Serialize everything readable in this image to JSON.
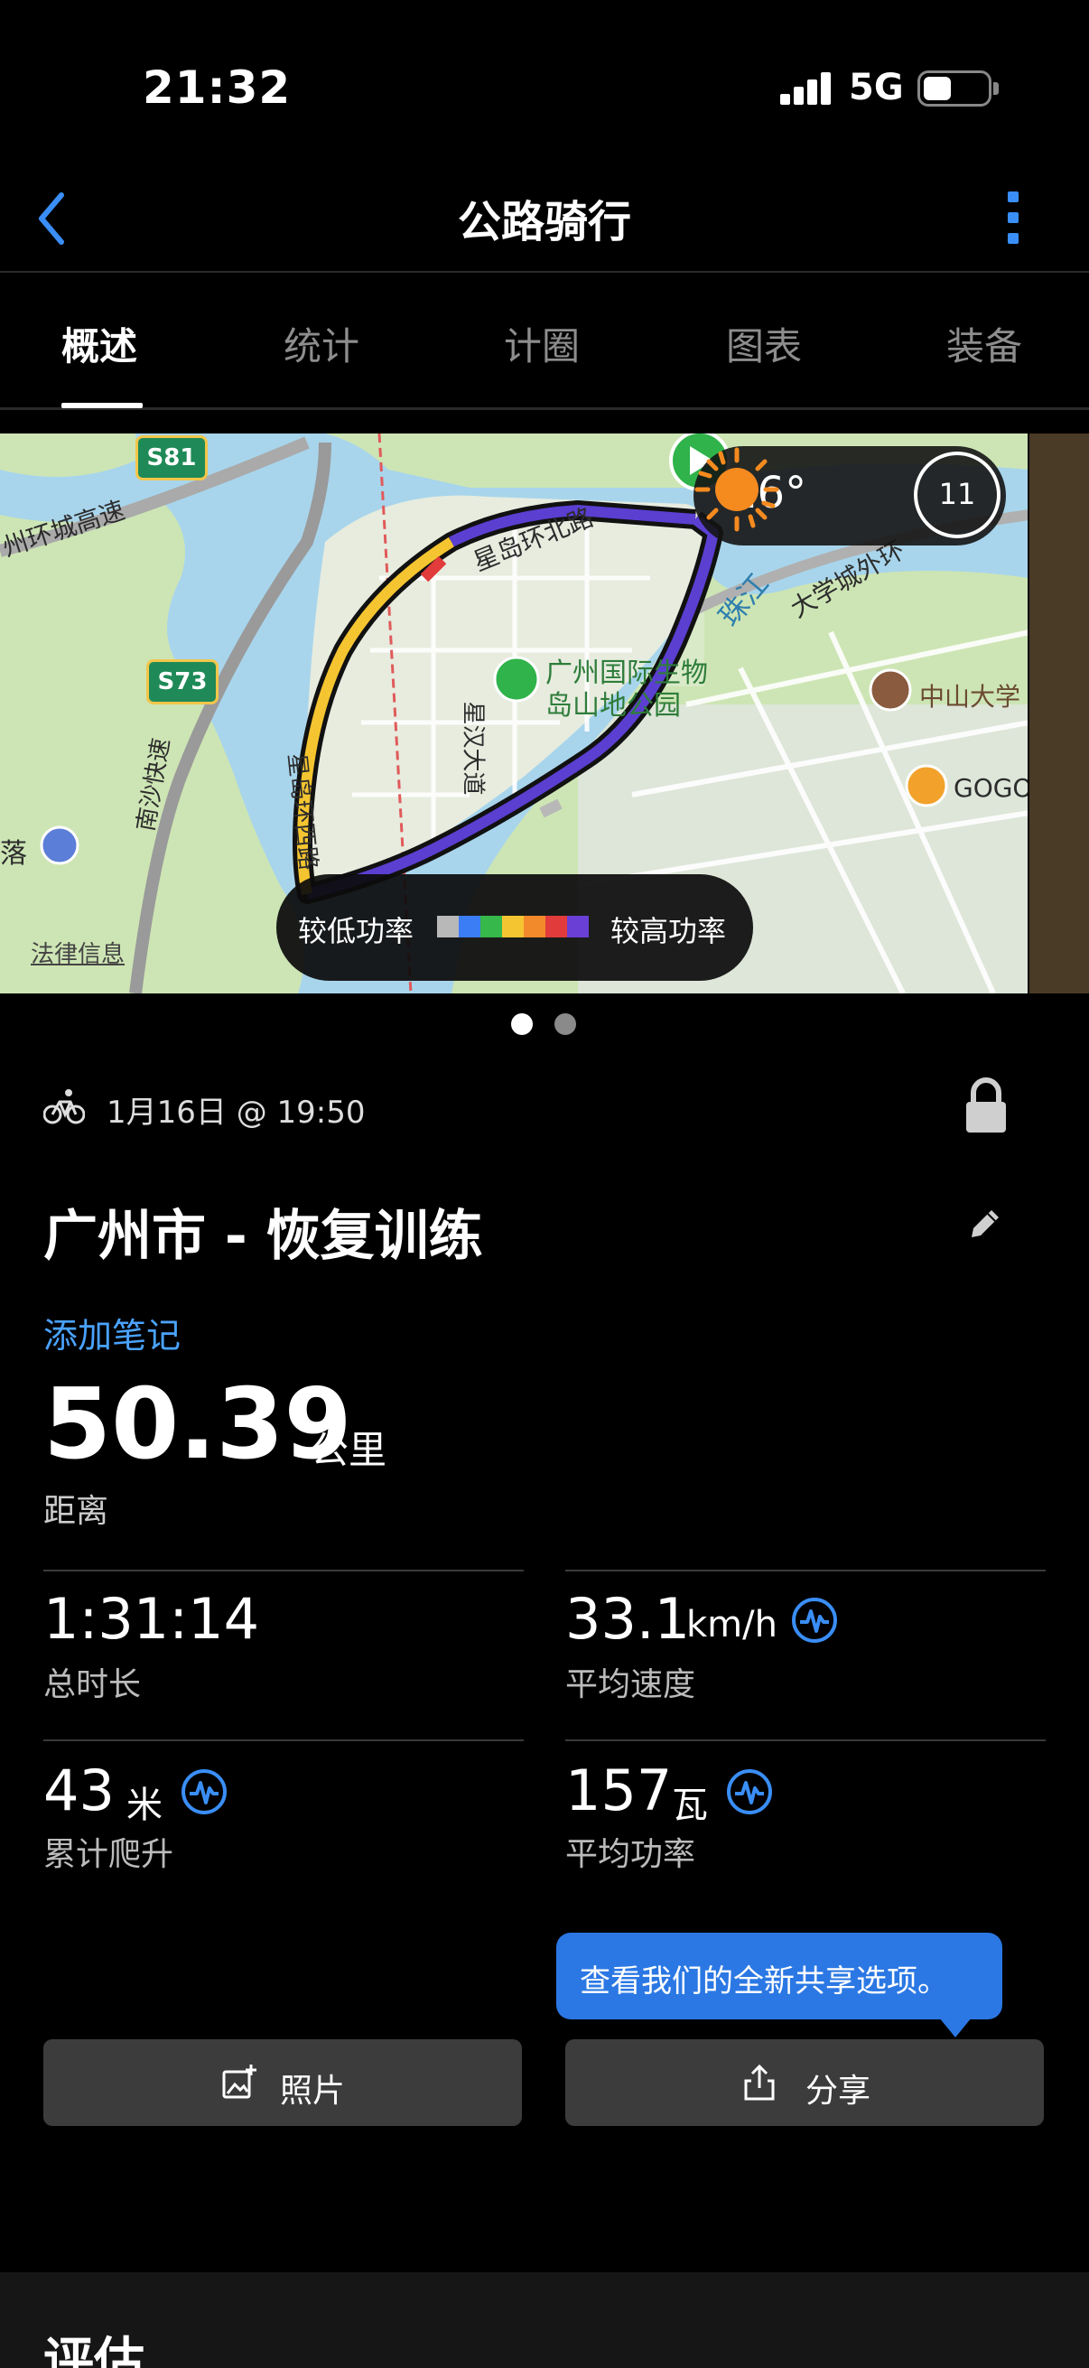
{
  "status_bar": {
    "time": "21:32",
    "network": "5G"
  },
  "nav": {
    "title": "公路骑行"
  },
  "tabs": [
    {
      "label": "概述",
      "active": true
    },
    {
      "label": "统计",
      "active": false
    },
    {
      "label": "计圈",
      "active": false
    },
    {
      "label": "图表",
      "active": false
    },
    {
      "label": "装备",
      "active": false
    }
  ],
  "map": {
    "labels": {
      "ring_expressway": "州环城高速",
      "road_north": "星岛环北路",
      "river": "珠江",
      "park": "广州国际生物",
      "park2": "岛山地公园",
      "univ_road": "大学城外环",
      "sysu": "中山大学",
      "gogo": "GOGO",
      "avenue": "星汉大道",
      "road_west": "星岛环西路",
      "south_road": "南沙快速",
      "left_place": "落",
      "legal": "法律信息",
      "s81": "S81",
      "s73": "S73"
    },
    "weather": {
      "temperature": "16°",
      "wind": "11",
      "icon": "sun-icon"
    },
    "legend": {
      "low": "较低功率",
      "high": "较高功率",
      "colors": [
        "#b8b8b8",
        "#3b7df5",
        "#36b84a",
        "#f5c531",
        "#f28a2b",
        "#e23b3b",
        "#6a3fd6"
      ]
    },
    "route_color": "#5b3fd1",
    "page_count": 2,
    "page_active": 0
  },
  "activity": {
    "date": "1月16日 @ 19:50",
    "title": "广州市 - 恢复训练",
    "add_note": "添加笔记",
    "distance": {
      "value": "50.39",
      "unit": "公里",
      "label": "距离"
    },
    "stats": [
      {
        "value": "1:31:14",
        "unit": "",
        "label": "总时长"
      },
      {
        "value": "33.1",
        "unit": "km/h",
        "label": "平均速度"
      },
      {
        "value": "43",
        "unit": "米",
        "label": "累计爬升"
      },
      {
        "value": "157",
        "unit": "瓦",
        "label": "平均功率"
      }
    ]
  },
  "tooltip": {
    "text": "查看我们的全新共享选项。"
  },
  "buttons": {
    "photos": "照片",
    "share": "分享"
  },
  "evaluation": {
    "title": "评估"
  },
  "colors": {
    "accent": "#3a8ef6",
    "link": "#4aa3ff",
    "tooltip": "#2b78e4"
  }
}
